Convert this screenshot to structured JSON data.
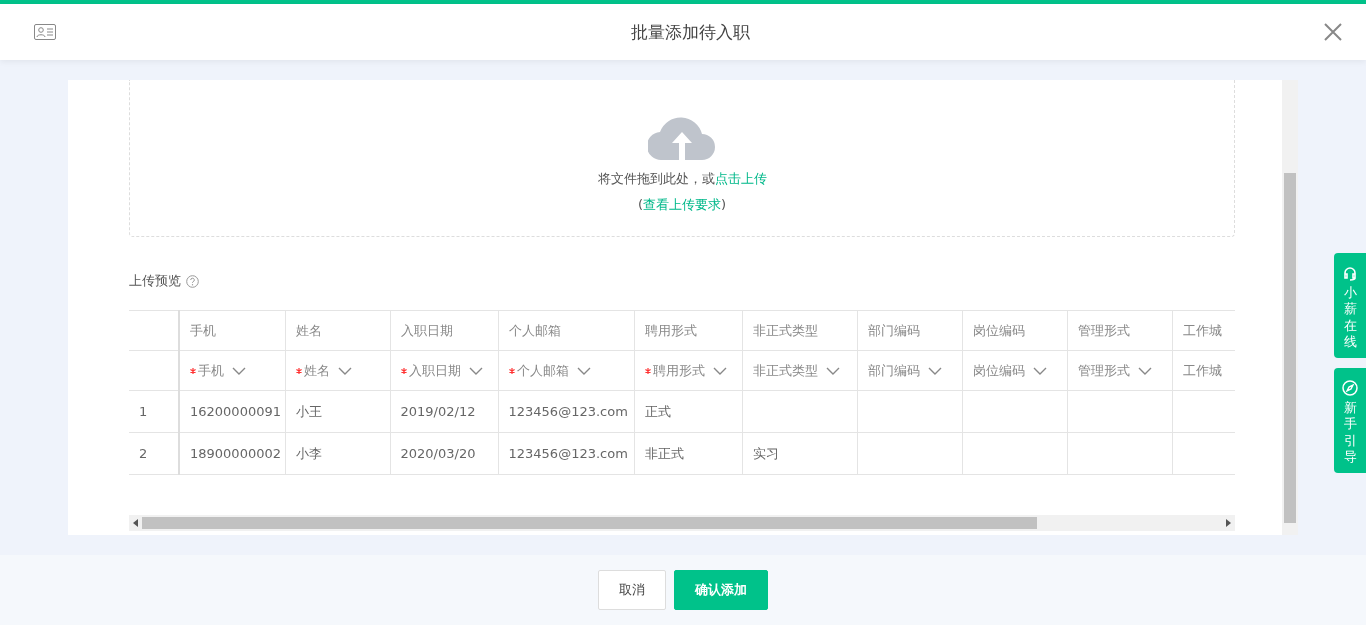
{
  "dialog": {
    "title": "批量添加待入职"
  },
  "upload": {
    "prompt": "将文件拖到此处，或",
    "link": "点击上传",
    "req_open": "(",
    "req_link": "查看上传要求",
    "req_close": ")"
  },
  "preview": {
    "title": "上传预览"
  },
  "table": {
    "columns": [
      {
        "header": "手机",
        "mapping": "手机",
        "required": true
      },
      {
        "header": "姓名",
        "mapping": "姓名",
        "required": true
      },
      {
        "header": "入职日期",
        "mapping": "入职日期",
        "required": true
      },
      {
        "header": "个人邮箱",
        "mapping": "个人邮箱",
        "required": true
      },
      {
        "header": "聘用形式",
        "mapping": "聘用形式",
        "required": true
      },
      {
        "header": "非正式类型",
        "mapping": "非正式类型",
        "required": false
      },
      {
        "header": "部门编码",
        "mapping": "部门编码",
        "required": false
      },
      {
        "header": "岗位编码",
        "mapping": "岗位编码",
        "required": false
      },
      {
        "header": "管理形式",
        "mapping": "管理形式",
        "required": false
      },
      {
        "header": "工作城",
        "mapping": "工作城",
        "required": false
      }
    ],
    "rows": [
      {
        "index": "1",
        "cells": [
          "16200000091",
          "小王",
          "2019/02/12",
          "123456@123.com",
          "正式",
          "",
          "",
          "",
          "",
          ""
        ]
      },
      {
        "index": "2",
        "cells": [
          "18900000002",
          "小李",
          "2020/03/20",
          "123456@123.com",
          "非正式",
          "实习",
          "",
          "",
          "",
          ""
        ]
      }
    ]
  },
  "side_buttons": [
    {
      "kind": "chat",
      "label": "小薪在线"
    },
    {
      "kind": "guide",
      "label": "新手引导"
    }
  ],
  "footer": {
    "cancel": "取消",
    "confirm": "确认添加"
  }
}
